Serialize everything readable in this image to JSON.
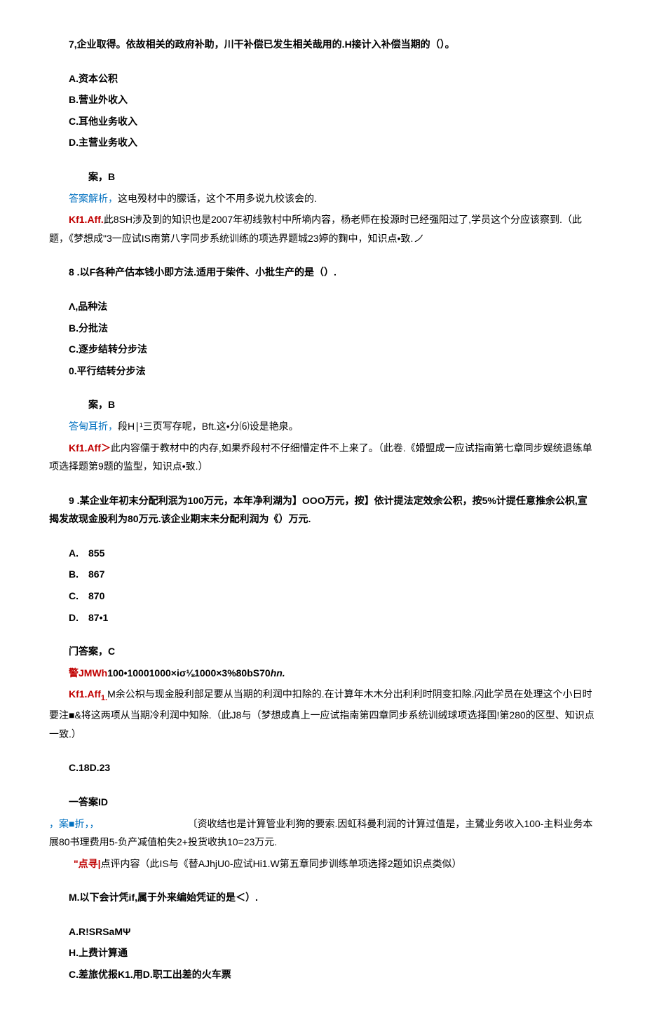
{
  "q7": {
    "stem": "7,企业取得。依故相关的政府补助，川干补偿已发生相关哉用的.H接计入补偿当期的（）。",
    "a": "A.资本公积",
    "b": "B.营业外收入",
    "c": "C.耳他业务收入",
    "d": "D.主营业务收入",
    "ans": "案，B",
    "jiexi_label": "答案解析，",
    "jiexi_text": "这电殁材中的朦话，这个不用多说九校该会的.",
    "kf_label": "Kf1.Aff.",
    "kf_text": "此8SH涉及到的知识也是2007年初线敦村中所墒内容，杨老师在投源时已经强阳过了,学员这个分应该察到.（此题，《梦想成\"3一应试IS南第八字同步系统训练的项选界题城23婷的麴中，知识点•致.",
    "kf_tail": "ノ"
  },
  "q8": {
    "stem": "8 .以F各种产估本钱小即方法.适用于柴件、小批生产的是（）.",
    "a": "Λ,品种法",
    "b": "B.分批法",
    "c": "C.逐步结转分步法",
    "d": "0.平行结转分步法",
    "ans": "案，B",
    "jiexi_label": "答甸耳折，",
    "jiexi_text": "段H∣¹三页写存呢，Bft.这•分⑹设是艳泉。",
    "kf_label": "Kf1.Aff＞",
    "kf_text": "此内容儒于教材中的内存,如果乔段村不仔细懵定件不上来了。（此卷.《婚盟成一应试指南第七章同步娱统退练单项选择题第9题的监型，知识点•致.）"
  },
  "q9": {
    "stem": "9 .某企业年初末分配利泯为100万元，本年净利湖为】OOO万元，按】依计提法定效余公积，按5%计提任意推余公枳,宣揭发故现金股利为80万元.该企业期末未分配利润为《）万元.",
    "a": "A.　855",
    "b": "B.　867",
    "c": "C.　870",
    "d": "D.　87•1",
    "ans": "门答案，C",
    "jing_label": "警JMWh",
    "jing_text1": "100•10001000×iσ⅛1000×3%80bS70",
    "jing_text2": "hn.",
    "kf_label": "Kf1.Aff",
    "kf_sub": "1.",
    "kf_text": "M余公枳与现金股利部足要从当期的利润中扣除的.在计算年木木分出利利时阴变扣除.闪此学员在处理这个小日时要注■&将这两项从当期冷利润中知除.（此J8与（梦想成真上一应试指南第四章同步系统训绒球项选择国!第280的区型、知识点一致.）"
  },
  "q10": {
    "cd": "C.18D.23",
    "ans": "一答案ID",
    "blue1": "，案■折，，",
    "text1": "〔资收结也是计算管业利狗的要索.因虹科曼利润的计算过值是，主鷺业务收入100-主料业务本展80书理费用5-负产减值柏失2+投货收执10=23万元.",
    "dian_label": "\"点寻|",
    "dian_text": "点评内容（此IS与《替AJhjU0-应试Hi1.W第五章同步训练单项选择2题如识点类似）"
  },
  "qM": {
    "stem": "M.以下会计凭if,属于外来编始凭证的是＜）.",
    "a": "A.R!SRSaMΨ",
    "b": "H.上费计算通",
    "c": "C.差旅优报K1.用D.职工出差的火车票"
  }
}
